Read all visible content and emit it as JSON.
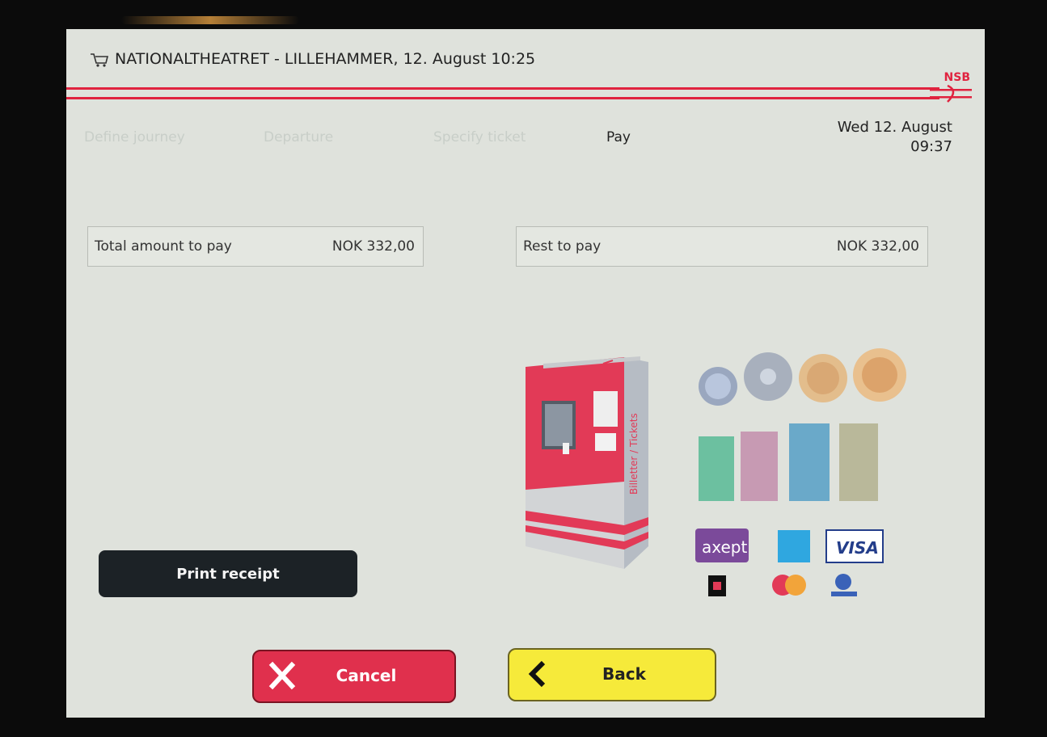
{
  "header": {
    "title": "NATIONALTHEATRET - LILLEHAMMER, 12. August 10:25",
    "brand": "NSB"
  },
  "steps": [
    {
      "label": "Define journey",
      "state": "done"
    },
    {
      "label": "Departure",
      "state": "done"
    },
    {
      "label": "Specify ticket",
      "state": "done"
    },
    {
      "label": "Pay",
      "state": "active"
    }
  ],
  "datetime": {
    "date": "Wed 12. August",
    "time": "09:37"
  },
  "total": {
    "label": "Total amount to pay",
    "value": "NOK 332,00"
  },
  "rest": {
    "label": "Rest to pay",
    "value": "NOK 332,00"
  },
  "kiosk": {
    "side_text": "Billetter / Tickets"
  },
  "payment_methods": {
    "coins": 4,
    "banknotes": 4,
    "cards": [
      "axept",
      "amex",
      "VISA",
      "coop",
      "mastercard",
      "maestro"
    ],
    "axept_label": "axept",
    "visa_label": "VISA"
  },
  "buttons": {
    "receipt": "Print receipt",
    "cancel": "Cancel",
    "back": "Back"
  },
  "colors": {
    "accent": "#e0233f",
    "cancel": "#e0304d",
    "back": "#f6ea3a",
    "receipt": "#1c2226",
    "screen": "#dfe2dc"
  }
}
